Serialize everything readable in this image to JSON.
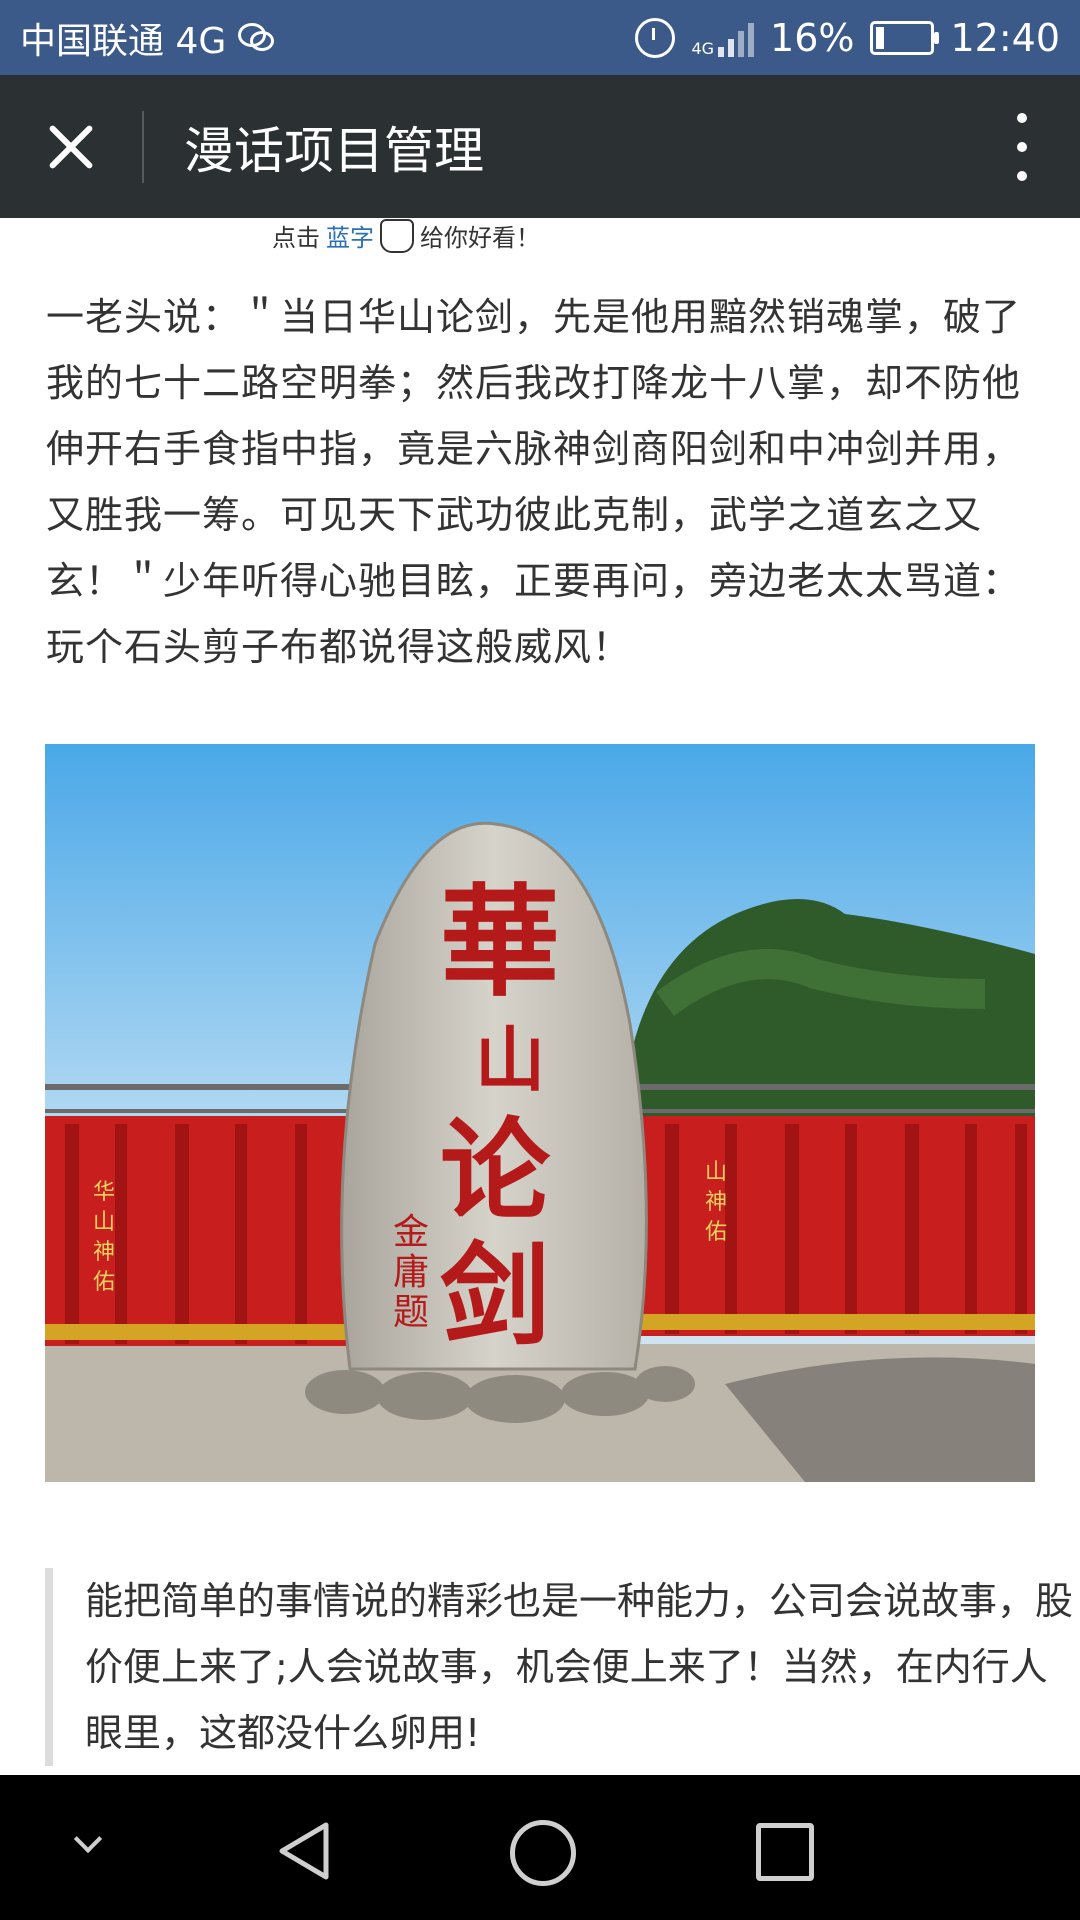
{
  "status_bar": {
    "carrier": "中国联通 4G",
    "network_small": "4G",
    "battery": "16%",
    "time": "12:40",
    "battery_level": 0.16,
    "icons": [
      "wechat-icon",
      "alarm-icon",
      "signal-icon",
      "battery-icon"
    ]
  },
  "app_bar": {
    "title": "漫话项目管理",
    "icons": [
      "close-icon",
      "more-icon"
    ]
  },
  "article": {
    "hint_prefix": "点击",
    "hint_link": "蓝字",
    "hint_suffix": "给你好看！",
    "paragraph": "一老头说：＂当日华山论剑，先是他用黯然销魂掌，破了我的七十二路空明拳；然后我改打降龙十八掌，却不防他伸开右手食指中指，竟是六脉神剑商阳剑和中冲剑并用，又胜我一筹。可见天下武功彼此克制，武学之道玄之又玄！＂少年听得心驰目眩，正要再问，旁边老太太骂道：玩个石头剪子布都说得这般威风！",
    "photo": {
      "stone_text": [
        "華",
        "山",
        "论",
        "剑"
      ],
      "signature": "金庸题",
      "ribbon_text": [
        "华",
        "山",
        "神",
        "佑"
      ]
    },
    "quote": "能把简单的事情说的精彩也是一种能力，公司会说故事，股价便上来了;人会说故事，机会便上来了！当然，在内行人眼里，这都没什么卵用!"
  },
  "nav_bar": {
    "icons": [
      "chevron-down-icon",
      "back-icon",
      "home-icon",
      "recent-apps-icon"
    ]
  },
  "colors": {
    "status_bar": "#3b5a8a",
    "app_bar": "#2b3033",
    "link_blue": "#2b6fb5",
    "ribbon_red": "#c81e1e"
  }
}
